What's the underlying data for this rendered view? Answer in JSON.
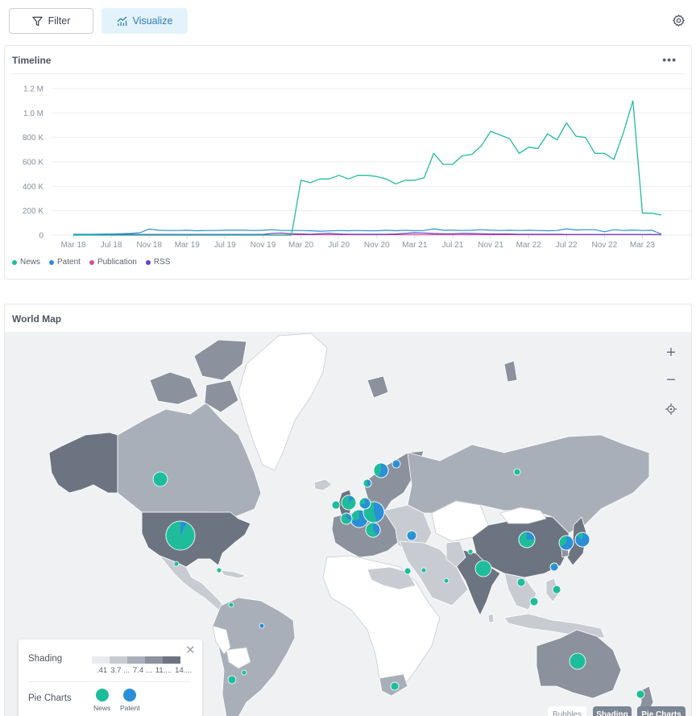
{
  "toolbar": {
    "filter_label": "Filter",
    "visualize_label": "Visualize",
    "icons": {
      "filter": "funnel-icon",
      "visualize": "chart-icon",
      "settings": "gear-icon"
    }
  },
  "timeline": {
    "title": "Timeline",
    "menu_label": "•••",
    "colors": {
      "News": "#1fbc9c",
      "Patent": "#2a8fd6",
      "Publication": "#d64ca2",
      "RSS": "#6a3fc4"
    }
  },
  "chart_data": {
    "type": "line",
    "title": "Timeline",
    "xlabel": "",
    "ylabel": "",
    "ylim": [
      0,
      1200000
    ],
    "yticks": [
      0,
      200000,
      400000,
      600000,
      800000,
      1000000,
      1200000
    ],
    "ytick_labels": [
      "0",
      "200 K",
      "400 K",
      "600 K",
      "800 K",
      "1.0 M",
      "1.2 M"
    ],
    "xtick_labels": [
      "Mar 18",
      "Jul 18",
      "Nov 18",
      "Mar 19",
      "Jul 19",
      "Nov 19",
      "Mar 20",
      "Jul 20",
      "Nov 20",
      "Mar 21",
      "Jul 21",
      "Nov 21",
      "Mar 22",
      "Jul 22",
      "Nov 22",
      "Mar 23"
    ],
    "x_start": "Mar 18",
    "x_interval": "month",
    "grid": true,
    "legend_position": "bottom-left",
    "series": [
      {
        "name": "News",
        "values": [
          0,
          0,
          0,
          0,
          0,
          0,
          0,
          0,
          0,
          0,
          0,
          0,
          0,
          0,
          0,
          0,
          0,
          0,
          0,
          0,
          0,
          0,
          0,
          0,
          450000,
          430000,
          460000,
          460000,
          490000,
          460000,
          490000,
          490000,
          480000,
          460000,
          420000,
          450000,
          450000,
          470000,
          670000,
          580000,
          580000,
          650000,
          660000,
          730000,
          850000,
          820000,
          790000,
          670000,
          720000,
          710000,
          830000,
          780000,
          920000,
          810000,
          800000,
          670000,
          670000,
          620000,
          840000,
          1100000,
          180000,
          180000,
          165000
        ]
      },
      {
        "name": "Patent",
        "values": [
          8000,
          8000,
          8000,
          9000,
          10000,
          12000,
          14000,
          20000,
          50000,
          40000,
          38000,
          38000,
          40000,
          36000,
          38000,
          38000,
          40000,
          40000,
          40000,
          38000,
          40000,
          45000,
          38000,
          38000,
          38000,
          36000,
          32000,
          35000,
          38000,
          36000,
          38000,
          36000,
          36000,
          40000,
          36000,
          40000,
          36000,
          38000,
          52000,
          40000,
          40000,
          38000,
          40000,
          45000,
          40000,
          38000,
          40000,
          38000,
          40000,
          38000,
          36000,
          38000,
          52000,
          42000,
          45000,
          45000,
          28000,
          45000,
          38000,
          42000,
          38000,
          40000,
          10000
        ]
      },
      {
        "name": "Publication",
        "values": [
          2000,
          2000,
          2000,
          2000,
          2000,
          2000,
          2000,
          2000,
          2000,
          2000,
          2000,
          2000,
          2000,
          2000,
          2000,
          2000,
          2000,
          2000,
          2000,
          2000,
          2000,
          2000,
          3000,
          4000,
          4000,
          4000,
          4000,
          4000,
          4000,
          4000,
          4000,
          4000,
          4000,
          4000,
          4000,
          4000,
          4000,
          4000,
          4000,
          4000,
          4000,
          4000,
          4000,
          4000,
          4000,
          4000,
          4000,
          4000,
          4000,
          4000,
          4000,
          4000,
          4000,
          4000,
          4000,
          4000,
          4000,
          4000,
          4000,
          4000,
          4000,
          4000,
          3000
        ]
      },
      {
        "name": "RSS",
        "values": [
          5000,
          6000,
          6000,
          6000,
          6000,
          6000,
          6000,
          6000,
          6000,
          6000,
          6000,
          6000,
          6000,
          6000,
          6000,
          6000,
          6000,
          6000,
          6000,
          6000,
          6000,
          15000,
          18000,
          12000,
          10000,
          8000,
          12000,
          15000,
          10000,
          8000,
          8000,
          8000,
          8000,
          8000,
          10000,
          15000,
          20000,
          18000,
          14000,
          12000,
          12000,
          15000,
          14000,
          12000,
          10000,
          10000,
          10000,
          8000,
          8000,
          8000,
          8000,
          8000,
          6000,
          6000,
          6000,
          6000,
          6000,
          6000,
          6000,
          6000,
          6000,
          6000,
          5000
        ]
      }
    ]
  },
  "world_map": {
    "title": "World Map",
    "controls": {
      "zoom_in": "+",
      "zoom_out": "−",
      "locate": "locate-icon"
    },
    "legend": {
      "shading_label": "Shading",
      "shading_colors": [
        "#e8eaed",
        "#c8ccd2",
        "#a9afb8",
        "#8b929d",
        "#6c7481"
      ],
      "shading_ranges": [
        ".41",
        "3.7 ...",
        "7.4 ...",
        "11....",
        "14...."
      ],
      "pie_label": "Pie Charts",
      "pie_keys": [
        {
          "name": "News",
          "color": "#1fbc9c"
        },
        {
          "name": "Patent",
          "color": "#2a8fd6"
        }
      ],
      "close_label": "✕"
    },
    "modes": {
      "bubbles": "Bubbles",
      "shading": "Shading",
      "pie_charts": "Pie Charts"
    },
    "pies": [
      {
        "region": "Canada",
        "news": 1.0
      },
      {
        "region": "United States",
        "news": 0.93
      },
      {
        "region": "Mexico",
        "news": 1.0
      },
      {
        "region": "Cuba",
        "news": 1.0
      },
      {
        "region": "Colombia",
        "news": 1.0
      },
      {
        "region": "Brazil",
        "news": 0.0
      },
      {
        "region": "Argentina",
        "news": 1.0
      },
      {
        "region": "Chile",
        "news": 1.0
      },
      {
        "region": "United Kingdom",
        "news": 0.85
      },
      {
        "region": "Ireland",
        "news": 1.0
      },
      {
        "region": "France",
        "news": 0.3
      },
      {
        "region": "Germany",
        "news": 0.55
      },
      {
        "region": "Netherlands",
        "news": 0.3
      },
      {
        "region": "Italy",
        "news": 0.6
      },
      {
        "region": "Spain",
        "news": 0.7
      },
      {
        "region": "Sweden",
        "news": 0.45
      },
      {
        "region": "Finland",
        "news": 0.0
      },
      {
        "region": "Norway",
        "news": 0.6
      },
      {
        "region": "Turkey",
        "news": 0.1
      },
      {
        "region": "Russia",
        "news": 1.0
      },
      {
        "region": "India",
        "news": 1.0
      },
      {
        "region": "China",
        "news": 0.75
      },
      {
        "region": "South Korea",
        "news": 0.35
      },
      {
        "region": "Japan",
        "news": 0.15
      },
      {
        "region": "Taiwan",
        "news": 0.1
      },
      {
        "region": "Thailand",
        "news": 1.0
      },
      {
        "region": "Philippines",
        "news": 1.0
      },
      {
        "region": "Malaysia",
        "news": 1.0
      },
      {
        "region": "Australia",
        "news": 1.0
      },
      {
        "region": "New Zealand",
        "news": 1.0
      },
      {
        "region": "South Africa",
        "news": 1.0
      },
      {
        "region": "Israel",
        "news": 1.0
      },
      {
        "region": "UAE",
        "news": 1.0
      },
      {
        "region": "Egypt",
        "news": 1.0
      },
      {
        "region": "Pakistan",
        "news": 1.0
      }
    ]
  }
}
